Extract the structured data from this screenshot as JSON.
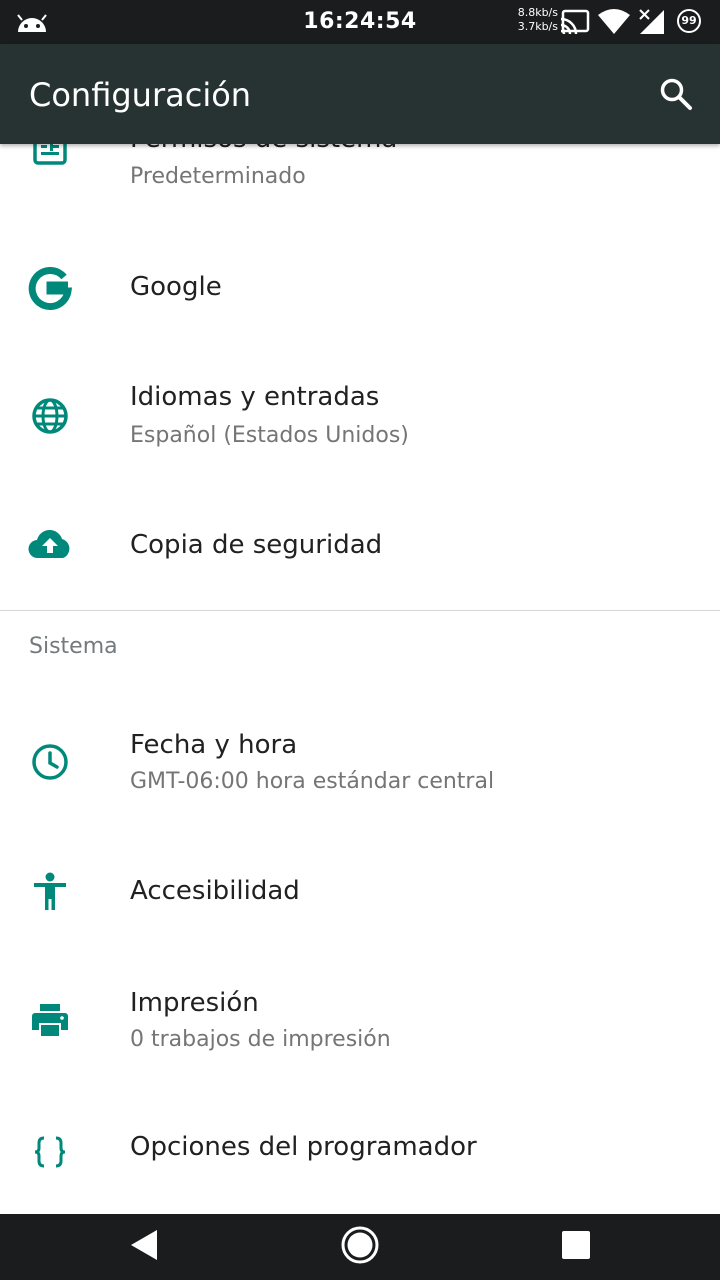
{
  "status_bar": {
    "time": "16:24:54",
    "speed_down": "8.8kb/s",
    "speed_up": "3.7kb/s",
    "battery": "99"
  },
  "app_bar": {
    "title": "Configuración",
    "search_icon": "search-icon"
  },
  "settings": {
    "items_top": [
      {
        "icon": "system-apps-icon",
        "title": "Permisos de sistema",
        "summary": "Predeterminado"
      },
      {
        "icon": "google-icon",
        "title": "Google",
        "summary": ""
      },
      {
        "icon": "globe-icon",
        "title": "Idiomas y entradas",
        "summary": "Español (Estados Unidos)"
      },
      {
        "icon": "cloud-upload-icon",
        "title": "Copia de seguridad",
        "summary": ""
      }
    ],
    "section_system": "Sistema",
    "items_system": [
      {
        "icon": "clock-icon",
        "title": "Fecha y hora",
        "summary": "GMT-06:00 hora estándar central"
      },
      {
        "icon": "accessibility-icon",
        "title": "Accesibilidad",
        "summary": ""
      },
      {
        "icon": "printer-icon",
        "title": "Impresión",
        "summary": "0 trabajos de impresión"
      },
      {
        "icon": "code-braces-icon",
        "title": "Opciones del programador",
        "summary": ""
      }
    ]
  },
  "colors": {
    "accent": "#00897b",
    "app_bar": "#263332",
    "status_bar": "#1b1c1d"
  }
}
